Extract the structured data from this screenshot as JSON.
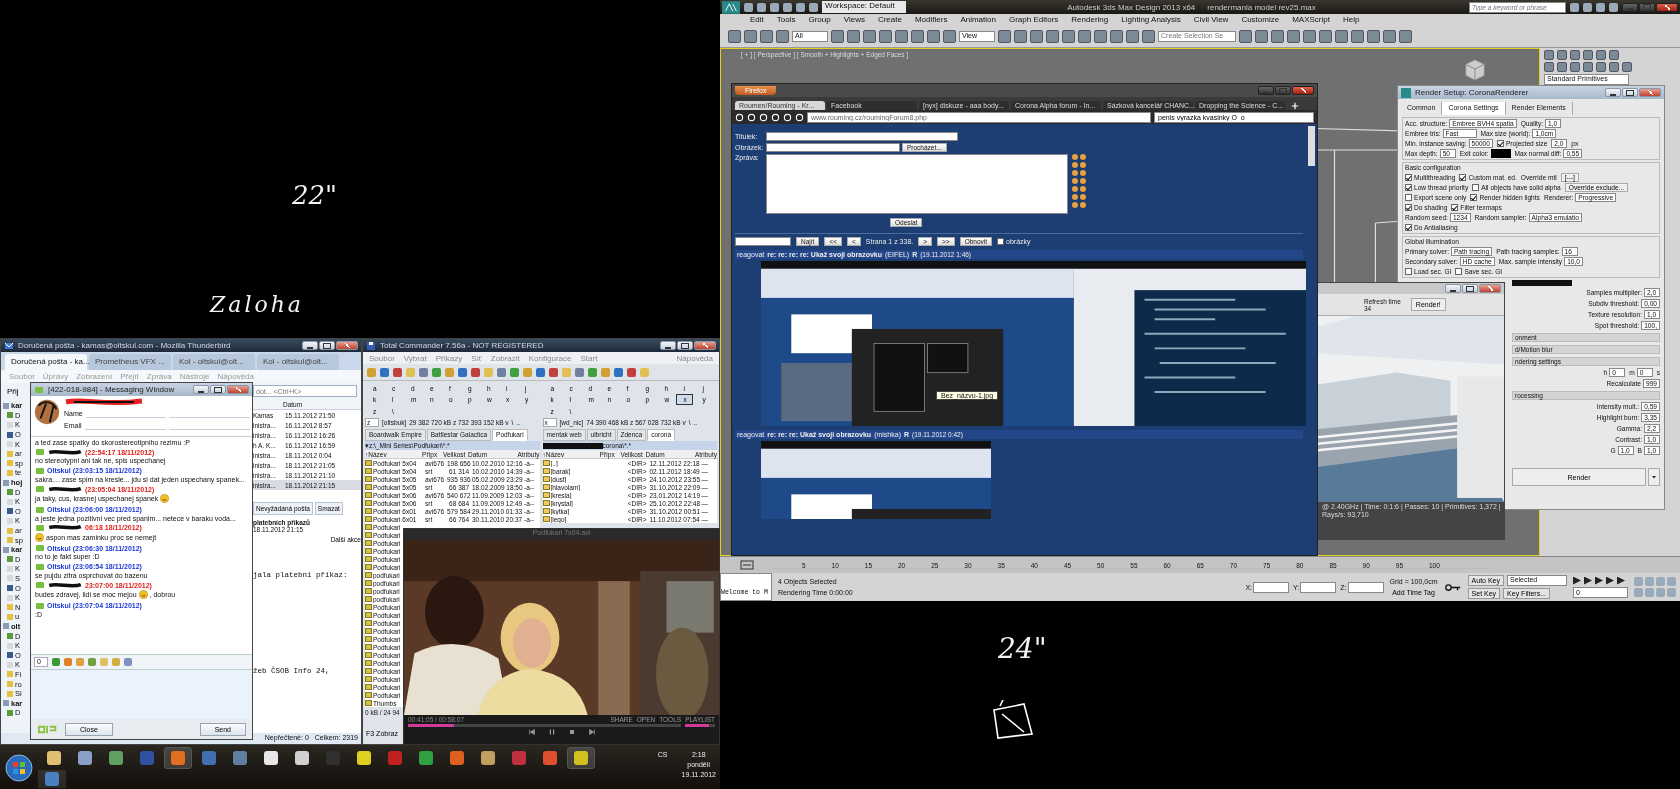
{
  "desktop_notes": [
    {
      "text": "22\""
    },
    {
      "text": "Zaloha"
    },
    {
      "text": "24\""
    }
  ],
  "thunderbird": {
    "title": "Doručená pošta - kamas@oltskul.com - Mozilla Thunderbird",
    "tabs": [
      {
        "label": "Doručená pošta - ka...",
        "selected": true
      },
      {
        "label": "Prometheus VFX ...",
        "selected": false
      },
      {
        "label": "Kol - oltskul@olt...",
        "selected": false
      },
      {
        "label": "Kol - oltskul@olt...",
        "selected": false
      }
    ],
    "menu": [
      "Soubor",
      "Úpravy",
      "Zobrazení",
      "Přejít",
      "Zpráva",
      "Nástroje",
      "Nápověda"
    ],
    "get_mail": "Přij",
    "search_placeholder": "dot... <Ctrl+K>",
    "sidebar": [
      {
        "label": "kar",
        "kind": "account"
      },
      {
        "label": "D",
        "kind": "inbox"
      },
      {
        "label": "K",
        "kind": "page"
      },
      {
        "label": "O",
        "kind": "sent"
      },
      {
        "label": "K",
        "kind": "page"
      },
      {
        "label": "ar",
        "kind": "folder"
      },
      {
        "label": "sp",
        "kind": "folder"
      },
      {
        "label": "te",
        "kind": "folder"
      },
      {
        "label": "hoj",
        "kind": "account"
      },
      {
        "label": "D",
        "kind": "inbox"
      },
      {
        "label": "K",
        "kind": "page"
      },
      {
        "label": "O",
        "kind": "sent"
      },
      {
        "label": "K",
        "kind": "page"
      },
      {
        "label": "ar",
        "kind": "folder"
      },
      {
        "label": "sp",
        "kind": "folder"
      },
      {
        "label": "kar",
        "kind": "account"
      },
      {
        "label": "D",
        "kind": "inbox"
      },
      {
        "label": "K",
        "kind": "page"
      },
      {
        "label": "S",
        "kind": "page"
      },
      {
        "label": "O",
        "kind": "sent"
      },
      {
        "label": "K",
        "kind": "page"
      },
      {
        "label": "N",
        "kind": "folder"
      },
      {
        "label": "u",
        "kind": "folder"
      },
      {
        "label": "olt",
        "kind": "account"
      },
      {
        "label": "D",
        "kind": "inbox"
      },
      {
        "label": "K",
        "kind": "page"
      },
      {
        "label": "O",
        "kind": "sent"
      },
      {
        "label": "K",
        "kind": "page"
      },
      {
        "label": "Fi",
        "kind": "folder"
      },
      {
        "label": "ro",
        "kind": "folder"
      },
      {
        "label": "Si",
        "kind": "folder"
      },
      {
        "label": "kar",
        "kind": "account"
      },
      {
        "label": "D",
        "kind": "inbox"
      }
    ],
    "column": "Datum",
    "rows": [
      {
        "sender": "Kamas",
        "date": "15.11.2012 21:50",
        "selected": false
      },
      {
        "sender": "inistra...",
        "date": "16.11.2012 8:57",
        "selected": false
      },
      {
        "sender": "inistra...",
        "date": "16.11.2012 16:26",
        "selected": false
      },
      {
        "sender": "h A. K...",
        "date": "16.11.2012 16:59",
        "selected": false
      },
      {
        "sender": "inistra...",
        "date": "18.11.2012 0:04",
        "selected": false
      },
      {
        "sender": "inistra...",
        "date": "18.11.2012 21:05",
        "selected": false
      },
      {
        "sender": "inistra...",
        "date": "18.11.2012 21:10",
        "selected": false
      },
      {
        "sender": "inistra...",
        "date": "18.11.2012 21:15",
        "selected": true
      }
    ],
    "buttons": [
      "Nevyžádaná pošta",
      "Smazat"
    ],
    "subject": "platebních příkazů",
    "subject_date": "18.11.2012 21:15",
    "more": "Další akce",
    "body": [
      "jala platební příkaz:",
      "žeb ČSOB Info 24,"
    ],
    "status": [
      "Nepřečtené: 0",
      "Celkem: 2319"
    ]
  },
  "messenger": {
    "title": "[422-018-984] - Messaging Window",
    "name_label": "Name",
    "email_label": "Email",
    "messages": [
      {
        "kind": "plain",
        "text": "a ted zase spatky do skorostereotipniho rezimu :P",
        "emoji_before": false,
        "emoji_after": false
      },
      {
        "kind": "theirs",
        "header": "(22:54:17 18/11/2012)",
        "text": "no stereotypni ani tak ne, spis uspechanej",
        "emoji_before": false,
        "emoji_after": false
      },
      {
        "kind": "mine",
        "header": "Oltskul (23:03:15 18/11/2012)",
        "text": "sakra.... zase spim na kresle... jdu si dat jeden uspechany spanek...",
        "emoji_before": false,
        "emoji_after": false
      },
      {
        "kind": "theirs",
        "header": "(23:05:04 18/11/2012)",
        "text": "ja taky, cus, krasnej uspechanej spanek",
        "emoji_before": false,
        "emoji_after": true
      },
      {
        "kind": "mine",
        "header": "Oltskul (23:06:00 18/11/2012)",
        "text": "a jeste jedna pozitivni vec pred spanim... netece v baraku voda...",
        "emoji_before": false,
        "emoji_after": false
      },
      {
        "kind": "theirs",
        "header": "06:18 18/11/2012)",
        "text": "aspon mas zaminku proc se nemejt",
        "emoji_before": true,
        "emoji_after": false
      },
      {
        "kind": "mine",
        "header": "Oltskul (23:06:30 18/11/2012)",
        "text": "no to je fakt super :D",
        "emoji_before": false,
        "emoji_after": false
      },
      {
        "kind": "mine",
        "header": "Oltskul (23:06:54 18/11/2012)",
        "text": "se pujdu zitra osprchovat do bazenu",
        "emoji_before": false,
        "emoji_after": false
      },
      {
        "kind": "theirs",
        "header": "23:07:00 18/11/2012)",
        "text": "budes zdravej, lidi se moc mejou",
        "emoji_before": false,
        "emoji_after": true,
        "text_after": ", dobrou"
      },
      {
        "kind": "mine",
        "header": "Oltskul (23:07:04 18/11/2012)",
        "text": ":D",
        "emoji_before": false,
        "emoji_after": false
      }
    ],
    "counter": "0",
    "close": "Close",
    "send": "Send"
  },
  "total_commander": {
    "title": "Total Commander 7.56a - NOT REGISTERED",
    "menu": [
      "Soubor",
      "Vybrat",
      "Příkazy",
      "Síť",
      "Zobrazit",
      "Konfigurace",
      "Start"
    ],
    "help": "Nápověda",
    "panels": [
      {
        "drives": [
          {
            "letter": "a",
            "selected": false
          },
          {
            "letter": "c",
            "selected": false
          },
          {
            "letter": "d",
            "selected": false
          },
          {
            "letter": "e",
            "selected": false
          },
          {
            "letter": "f",
            "selected": false
          },
          {
            "letter": "g",
            "selected": false
          },
          {
            "letter": "h",
            "selected": false
          },
          {
            "letter": "i",
            "selected": false
          },
          {
            "letter": "j",
            "selected": false
          },
          {
            "letter": "k",
            "selected": false
          },
          {
            "letter": "l",
            "selected": false
          },
          {
            "letter": "m",
            "selected": false
          },
          {
            "letter": "n",
            "selected": false
          },
          {
            "letter": "o",
            "selected": false
          },
          {
            "letter": "p",
            "selected": false
          },
          {
            "letter": "w",
            "selected": false
          },
          {
            "letter": "x",
            "selected": false
          },
          {
            "letter": "y",
            "selected": false
          },
          {
            "letter": "z",
            "selected": false
          },
          {
            "letter": "\\",
            "selected": false
          }
        ],
        "drive": "z",
        "label": "[oltsbuk]",
        "space": "29 382 720 kB z 732 393 152 kB v",
        "root": "\\",
        "up": "..",
        "tabs": [
          {
            "label": "Boardwalk Empire",
            "selected": false
          },
          {
            "label": "Battlestar Galactica",
            "selected": false
          },
          {
            "label": "Podfukari",
            "selected": true
          }
        ],
        "path": "▾z:\\_Mini Series\\Podfukari\\*.*",
        "columns": [
          "↑Název",
          "Přípx",
          "Velikost",
          "Datum",
          "Atributy"
        ],
        "rows": [
          {
            "name": "Podfukari 5x04",
            "ext": "avi676",
            "size": "198 656",
            "date": "10.02.2010 12:16",
            "attr": "-a--"
          },
          {
            "name": "Podfukari 5x04",
            "ext": "srt",
            "size": "61 314",
            "date": "10.02.2010 14:39",
            "attr": "-a--"
          },
          {
            "name": "Podfukari 5x05",
            "ext": "avi676",
            "size": "935 936",
            "date": "05.02.2009 23:29",
            "attr": "-a--"
          },
          {
            "name": "Podfukari 5x05",
            "ext": "srt",
            "size": "66 387",
            "date": "18.02.2009 18:50",
            "attr": "-a--"
          },
          {
            "name": "Podfukari 5x06",
            "ext": "avi676",
            "size": "540 672",
            "date": "11.09.2009 12:03",
            "attr": "-a--"
          },
          {
            "name": "Podfukari 5x06",
            "ext": "srt",
            "size": "68 684",
            "date": "11.09.2009 12:49",
            "attr": "-a--"
          },
          {
            "name": "Podfukari 6x01",
            "ext": "avi676",
            "size": "579 584",
            "date": "29.11.2010 01:33",
            "attr": "-a--"
          },
          {
            "name": "Podfukari 6x01",
            "ext": "srt",
            "size": "66 764",
            "date": "30.11.2010 20:37",
            "attr": "-a--"
          },
          {
            "name": "Podfukari"
          },
          {
            "name": "Podfukari"
          },
          {
            "name": "Podfukari"
          },
          {
            "name": "Podfukari"
          },
          {
            "name": "Podfukari"
          },
          {
            "name": "Podfukari"
          },
          {
            "name": "podfukari"
          },
          {
            "name": "podfukari"
          },
          {
            "name": "podfukari"
          },
          {
            "name": "podfukari"
          },
          {
            "name": "Podfukari"
          },
          {
            "name": "Podfukari"
          },
          {
            "name": "Podfukari"
          },
          {
            "name": "Podfukari"
          },
          {
            "name": "Podfukari"
          },
          {
            "name": "Podfukari"
          },
          {
            "name": "Podfukari"
          },
          {
            "name": "Podfukari"
          },
          {
            "name": "Podfukari"
          },
          {
            "name": "Podfukari"
          },
          {
            "name": "Podfukari"
          },
          {
            "name": "Podfukari"
          },
          {
            "name": "Thumbs"
          }
        ],
        "footer": "0 kB / 24 94"
      },
      {
        "drives": [
          {
            "letter": "a",
            "selected": false
          },
          {
            "letter": "c",
            "selected": false
          },
          {
            "letter": "d",
            "selected": false
          },
          {
            "letter": "e",
            "selected": false
          },
          {
            "letter": "f",
            "selected": false
          },
          {
            "letter": "g",
            "selected": false
          },
          {
            "letter": "h",
            "selected": false
          },
          {
            "letter": "i",
            "selected": false
          },
          {
            "letter": "j",
            "selected": false
          },
          {
            "letter": "k",
            "selected": false
          },
          {
            "letter": "l",
            "selected": false
          },
          {
            "letter": "m",
            "selected": false
          },
          {
            "letter": "n",
            "selected": false
          },
          {
            "letter": "o",
            "selected": false
          },
          {
            "letter": "p",
            "selected": false
          },
          {
            "letter": "w",
            "selected": false
          },
          {
            "letter": "x",
            "selected": true
          },
          {
            "letter": "y",
            "selected": false
          },
          {
            "letter": "z",
            "selected": false
          },
          {
            "letter": "\\",
            "selected": false
          }
        ],
        "drive": "x",
        "label": "[wd_nic]",
        "space": "74 390 468 kB z 567 028 732 kB v",
        "root": "\\",
        "up": "..",
        "tabs": [
          {
            "label": "mentak web",
            "selected": false
          },
          {
            "label": "ulbricht",
            "selected": false
          },
          {
            "label": "Zdenca",
            "selected": false
          },
          {
            "label": "corona",
            "selected": true
          }
        ],
        "path": "corona\\*.*",
        "columns": [
          "↑Název",
          "Přípx",
          "Velikost",
          "Datum",
          "Atributy"
        ],
        "rows": [
          {
            "name": "[..]",
            "ext": "",
            "size": "<DIR>",
            "date": "12.11.2012 22:18",
            "attr": "—"
          },
          {
            "name": "[barak]",
            "size": "<DIR>",
            "date": "02.11.2012 18:49",
            "attr": "—"
          },
          {
            "name": "[dust]",
            "size": "<DIR>",
            "date": "24.10.2012 23:55",
            "attr": "—"
          },
          {
            "name": "[hlavolam]",
            "size": "<DIR>",
            "date": "31.10.2012 22:09",
            "attr": "—"
          },
          {
            "name": "[kresla]",
            "size": "<DIR>",
            "date": "23.01.2012 14:19",
            "attr": "—"
          },
          {
            "name": "[krystal]",
            "size": "<DIR>",
            "date": "25.10.2012 22:48",
            "attr": "—"
          },
          {
            "name": "[kytka]",
            "size": "<DIR>",
            "date": "31.10.2012 00:51",
            "attr": "—"
          },
          {
            "name": "[lego]",
            "size": "<DIR>",
            "date": "11.10.2012 07:54",
            "attr": "—"
          }
        ]
      }
    ],
    "fkey": "F3 Zobraz"
  },
  "video_player": {
    "title": "Podfukari 7x04.avi",
    "time": "00:41:05 / 00:58:07",
    "actions": [
      "SHARE",
      "OPEN",
      "TOOLS",
      "PLAYLIST"
    ],
    "progress": {
      "level": 0.17
    },
    "volume": {
      "level": 0.8
    }
  },
  "taskbar": {
    "language": "CS",
    "time": "2:18",
    "day": "pondělí",
    "date": "19.11.2012"
  },
  "max": {
    "title": "Autodesk 3ds Max Design 2013 x64",
    "file": "rendermania model rev25.max",
    "workspace": "Workspace: Default",
    "search_placeholder": "Type a keyword or phrase",
    "menu": [
      "Edit",
      "Tools",
      "Group",
      "Views",
      "Create",
      "Modifiers",
      "Animation",
      "Graph Editors",
      "Rendering",
      "Lighting Analysis",
      "Civil View",
      "Customize",
      "MAXScript",
      "Help"
    ],
    "filter": "All",
    "coord": "View",
    "selection_set": "Create Selection Se",
    "viewport_label": "[ + ] [ Perspective ] [ Smooth + Highlights + Edged Faces ]",
    "object_type": "Standard Primitives",
    "ticks": [
      "5",
      "10",
      "15",
      "20",
      "25",
      "30",
      "35",
      "40",
      "45",
      "50",
      "55",
      "60",
      "65",
      "70",
      "75",
      "80",
      "85",
      "90",
      "95",
      "100"
    ],
    "listener": "Welcome to M",
    "selected_count": "4 Objects Selected",
    "render_time": "Rendering Time 0:00:00",
    "axes": [
      "X:",
      "Y:",
      "Z:"
    ],
    "grid": "Grid = 100,0cm",
    "time_tag": "Add Time Tag",
    "auto_key": "Auto Key",
    "key_mode": "Selected",
    "set_key": "Set Key",
    "key_filters": "Key Filters...",
    "frame": "0"
  },
  "firefox": {
    "button": "Firefox",
    "tabs": [
      {
        "label": "Roumen/Rouming - Kr...",
        "selected": true
      },
      {
        "label": "Facebook",
        "selected": false
      },
      {
        "label": "[nyx] diskuze - aaa body...",
        "selected": false
      },
      {
        "label": "Corona Alpha forum - In...",
        "selected": false
      },
      {
        "label": "Sázková kancelář CHANC...",
        "selected": false
      },
      {
        "label": "Dropping the Science - C...",
        "selected": false
      }
    ],
    "url": "www.rouming.cz/roumingForum8.php",
    "search": "penis vyrazka kvasinky O_o",
    "form": {
      "title_label": "Titulek:",
      "image_label": "Obrázek:",
      "browse": "Procházet...",
      "message_label": "Zpráva:",
      "submit": "Odeslat"
    },
    "pager": {
      "find": "Najít",
      "first": "<<",
      "prev": "<",
      "page": "Strana 1 z 338.",
      "next": ">",
      "last": ">>",
      "refresh": "Obnovit",
      "images": {
        "label": "obrázky",
        "checked": false
      }
    },
    "posts": [
      {
        "reply": "reagovat",
        "subject": "re: re: re: re: Ukaž svoji obrazovku",
        "author": "(EIFEL)",
        "mark": "R",
        "date": "(19.11.2012 1:46)",
        "tooltip": "Bez_názvu-1.jpg"
      },
      {
        "reply": "reagovat",
        "subject": "re: re: re: Ukaž svoji obrazovku",
        "author": "(mishka)",
        "mark": "R",
        "date": "(19.11.2012 0:42)"
      }
    ]
  },
  "render_frame": {
    "refresh_label": "Refresh time",
    "refresh_value": "34",
    "render": "Render!",
    "status": "@ 2.40GHz | Time: 0:1:6 | Passes: 10 | Primitives: 1,372 | Rays/s: 93,710"
  },
  "render_setup": {
    "title": "Render Setup: CoronaRenderer",
    "tabs": [
      {
        "label": "Common",
        "selected": false
      },
      {
        "label": "Corona Settings",
        "selected": true
      },
      {
        "label": "Render Elements",
        "selected": false
      }
    ],
    "sections": [
      {
        "rows": [
          [
            {
              "kind": "drop",
              "label": "Acc. structure:",
              "value": "Embree BVH4 spatia"
            },
            {
              "kind": "spin",
              "label": "Quality:",
              "value": "1,0"
            }
          ],
          [
            {
              "kind": "drop",
              "label": "Embree tris:",
              "value": "Fast"
            },
            {
              "kind": "spin",
              "label": "Max size (world):",
              "value": "1,0cm"
            }
          ],
          [
            {
              "kind": "spin",
              "label": "Min. instance saving:",
              "value": "50000"
            },
            {
              "kind": "check",
              "label": "Projected size",
              "checked": true
            },
            {
              "kind": "spin",
              "value": "2,0"
            },
            {
              "kind": "text",
              "label": "px"
            }
          ],
          [
            {
              "kind": "spin",
              "label": "Max depth:",
              "value": "50"
            },
            {
              "kind": "swatch",
              "label": "Exit color:"
            },
            {
              "kind": "spin",
              "label": "Max normal diff:",
              "value": "0,55"
            }
          ]
        ]
      },
      {
        "title": "Basic configuration",
        "rows": [
          [
            {
              "kind": "check",
              "label": "Multithreading",
              "checked": true
            },
            {
              "kind": "check",
              "label": "Custom mat. ed.",
              "checked": true
            },
            {
              "kind": "text",
              "label": "Override mtl"
            },
            {
              "kind": "btn",
              "label": "[---]"
            }
          ],
          [
            {
              "kind": "check",
              "label": "Low thread priority",
              "checked": true
            },
            {
              "kind": "check",
              "label": "All objects have solid alpha",
              "checked": false
            },
            {
              "kind": "btn",
              "label": "Override exclude..."
            }
          ],
          [
            {
              "kind": "check",
              "label": "Export scene only",
              "checked": false
            },
            {
              "kind": "check",
              "label": "Render hidden lights",
              "checked": true
            },
            {
              "kind": "drop",
              "label": "Renderer:",
              "value": "Progressive"
            }
          ],
          [
            {
              "kind": "check",
              "label": "Do shading",
              "checked": true
            },
            {
              "kind": "check",
              "label": "Filter texmaps",
              "checked": true
            }
          ],
          [
            {
              "kind": "spin",
              "label": "Random seed:",
              "value": "1234"
            },
            {
              "kind": "drop",
              "label": "Random sampler:",
              "value": "Alpha3 emulatio"
            }
          ],
          [
            {
              "kind": "check",
              "label": "Do Antialiasing",
              "checked": true
            }
          ]
        ]
      },
      {
        "title": "Global illumination",
        "rows": [
          [
            {
              "kind": "drop",
              "label": "Primary solver:",
              "value": "Path tracing"
            },
            {
              "kind": "spin",
              "label": "Path tracing samples:",
              "value": "16"
            }
          ],
          [
            {
              "kind": "drop",
              "label": "Secondary solver:",
              "value": "HD cache"
            },
            {
              "kind": "spin",
              "label": "Max. sample intensity",
              "value": "10,0"
            }
          ],
          [
            {
              "kind": "check",
              "label": "Load sec. GI",
              "checked": false
            },
            {
              "kind": "check",
              "label": "Save sec. GI",
              "checked": false
            }
          ]
        ]
      }
    ],
    "lower": [
      {
        "rows": [
          [
            {
              "kind": "spin",
              "label": "Samples multiplier:",
              "value": "2,0"
            }
          ],
          [
            {
              "kind": "spin",
              "label": "Subdiv threshold:",
              "value": "0,00"
            }
          ],
          [
            {
              "kind": "spin",
              "label": "Texture resolution:",
              "value": "1,0"
            }
          ],
          [
            {
              "kind": "spin",
              "label": "Spot threshold:",
              "value": "100,"
            }
          ]
        ]
      },
      {
        "title": "onment"
      },
      {
        "title": "d/Motion blur"
      },
      {
        "title": "ndering settings",
        "rows": [
          [
            {
              "kind": "spin",
              "label": "h",
              "value": "0"
            },
            {
              "kind": "spin",
              "label": "m",
              "value": "0"
            },
            {
              "kind": "text",
              "label": "s"
            }
          ],
          [
            {
              "kind": "spin",
              "label": "Recalculate",
              "value": "999"
            }
          ]
        ]
      },
      {
        "title": "rocessing",
        "rows": [
          [
            {
              "kind": "spin",
              "label": "Intensity mult.:",
              "value": "0,59"
            }
          ],
          [
            {
              "kind": "spin",
              "label": "Highlight burn:",
              "value": "3,35"
            }
          ],
          [
            {
              "kind": "spin",
              "label": "Gamma:",
              "value": "2,2"
            }
          ],
          [
            {
              "kind": "spin",
              "label": "Contrast:",
              "value": "1,0"
            }
          ],
          [
            {
              "kind": "spin",
              "label": "G",
              "value": "1,0"
            },
            {
              "kind": "spin",
              "label": "B",
              "value": "1,0"
            }
          ]
        ]
      }
    ],
    "render": "Render"
  }
}
